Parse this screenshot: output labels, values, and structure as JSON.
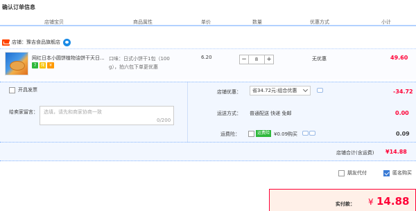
{
  "page_title": "确认订单信息",
  "columns": [
    "店铺宝贝",
    "商品属性",
    "单价",
    "数量",
    "优惠方式",
    "小计"
  ],
  "shop": {
    "label": "店铺：",
    "name": "豫吉食品旗舰店"
  },
  "item": {
    "name": "网红日本小圆饼植物油饼干天日...",
    "attr_line1": "口味：日式小饼干1包（100",
    "attr_line2": "g），拍六包下单更优惠",
    "price": "6.20",
    "qty_minus": "−",
    "qty": "8",
    "qty_plus": "+",
    "discount": "无优惠",
    "subtotal": "49.60",
    "service_icons": [
      "7",
      "保",
      "¥"
    ]
  },
  "options": {
    "invoice_label": "开具发票",
    "message_label": "给卖家留言：",
    "message_placeholder": "选填，请先和商家协商一致",
    "message_count": "0/200",
    "discount_label": "店铺优惠：",
    "discount_select": "省34.72元:组合优惠",
    "discount_value": "-34.72",
    "shipping_label": "运送方式：",
    "shipping_method": "普通配送 快递 免邮",
    "shipping_value": "0.00",
    "insurance_label": "运费险：",
    "insurance_tag": "运费险",
    "insurance_price": "¥0.09购买",
    "insurance_value": "0.09"
  },
  "shop_total": {
    "label": "店铺合计(含运费)",
    "value": "¥14.88"
  },
  "friend_pay_label": "朋友代付",
  "anonymous_label": "匿名购买",
  "anonymous_checked": true,
  "pay": {
    "label": "实付款：",
    "currency": "¥",
    "amount": "14.88"
  },
  "colors": {
    "accent_red": "#ff0036",
    "header_line": "#b2d1ff",
    "panel_bg": "#f2f7ff",
    "shop_badge": "#ff4400"
  }
}
